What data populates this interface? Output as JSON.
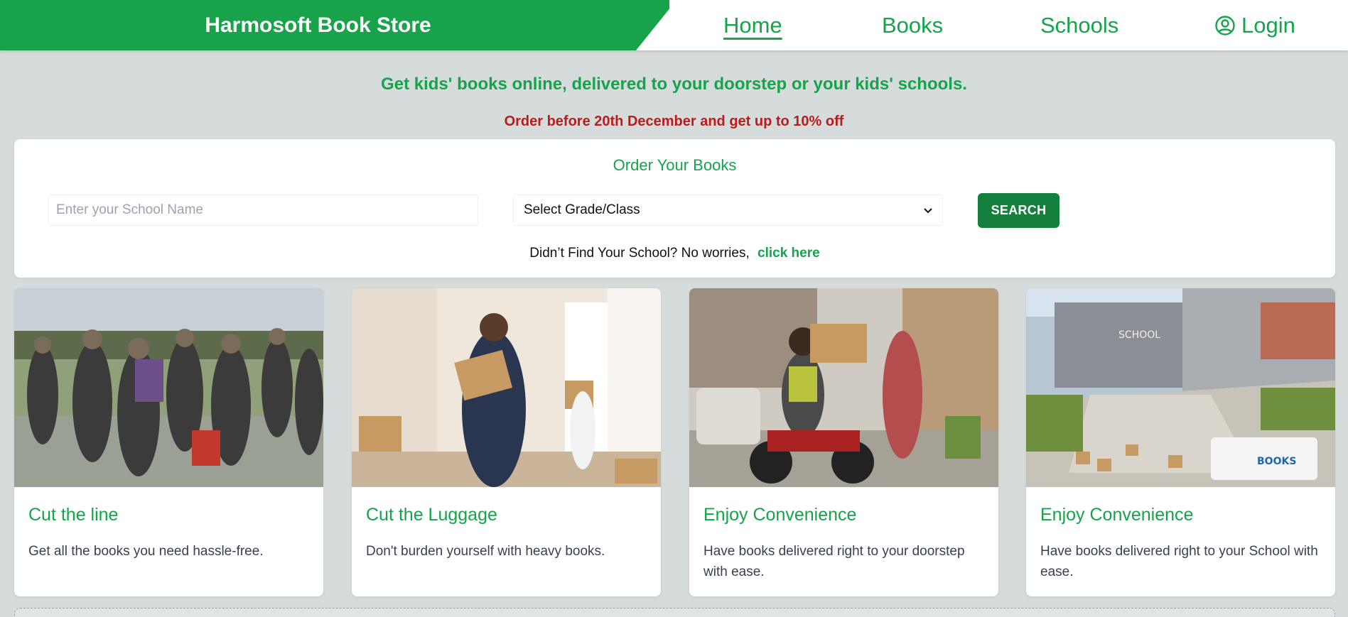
{
  "header": {
    "brand": "Harmosoft Book Store",
    "nav": [
      {
        "label": "Home",
        "active": true
      },
      {
        "label": "Books",
        "active": false
      },
      {
        "label": "Schools",
        "active": false
      },
      {
        "label": "Login",
        "active": false,
        "icon": "user-circle-icon"
      }
    ]
  },
  "taglines": {
    "main": "Get kids' books online, delivered to your doorstep or your kids' schools.",
    "promo": "Order before 20th December and get up to 10% off"
  },
  "order": {
    "title": "Order Your Books",
    "school_placeholder": "Enter your School Name",
    "school_value": "",
    "grade_selected": "Select Grade/Class",
    "search_label": "SEARCH",
    "not_found_text": "Didn’t Find Your School? No worries,",
    "not_found_link": "click here"
  },
  "cards": [
    {
      "title": "Cut the line",
      "description": "Get all the books you need hassle-free.",
      "image": "people-queue-photo"
    },
    {
      "title": "Cut the Luggage",
      "description": "Don't burden yourself with heavy books.",
      "image": "woman-carrying-boxes-photo"
    },
    {
      "title": "Enjoy Convenience",
      "description": "Have books delivered right to your doorstep with ease.",
      "image": "motorbike-delivery-photo"
    },
    {
      "title": "Enjoy Convenience",
      "description": "Have books delivered right to your School with ease.",
      "image": "school-delivery-van-photo"
    }
  ],
  "colors": {
    "brand_green": "#18a34a",
    "button_green": "#15803d",
    "promo_red": "#b91c1c",
    "page_bg": "#d6dcdc"
  }
}
